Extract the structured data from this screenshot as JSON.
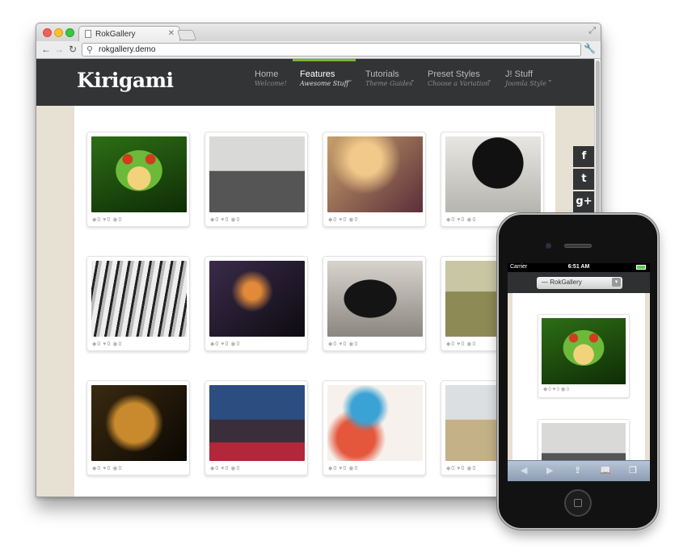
{
  "browser": {
    "tab_title": "RokGallery",
    "url": "rokgallery.demo"
  },
  "site": {
    "logo": "Kirigami",
    "menu": [
      {
        "title": "Home",
        "sub": "Welcome!"
      },
      {
        "title": "Features",
        "sub": "Awesome Stuff"
      },
      {
        "title": "Tutorials",
        "sub": "Theme Guides"
      },
      {
        "title": "Preset Styles",
        "sub": "Choose a Variation"
      },
      {
        "title": "J! Stuff",
        "sub": "Joomla Style"
      }
    ],
    "social": [
      "f",
      "t",
      "g+",
      "rss"
    ]
  },
  "gallery": {
    "stat_value": "0",
    "items": [
      {
        "name": "frog"
      },
      {
        "name": "woman-rock"
      },
      {
        "name": "guitar"
      },
      {
        "name": "black-hair"
      },
      {
        "name": "tiger"
      },
      {
        "name": "costume"
      },
      {
        "name": "horse"
      },
      {
        "name": "field"
      },
      {
        "name": "lion"
      },
      {
        "name": "london"
      },
      {
        "name": "watercolor"
      },
      {
        "name": "fields2"
      }
    ]
  },
  "phone": {
    "carrier": "Carrier",
    "time": "6:51 AM",
    "select_value": "— RokGallery"
  },
  "colors": {
    "header_bg": "#323436",
    "accent_green": "#7cb236",
    "page_bg": "#e7e1d3"
  }
}
